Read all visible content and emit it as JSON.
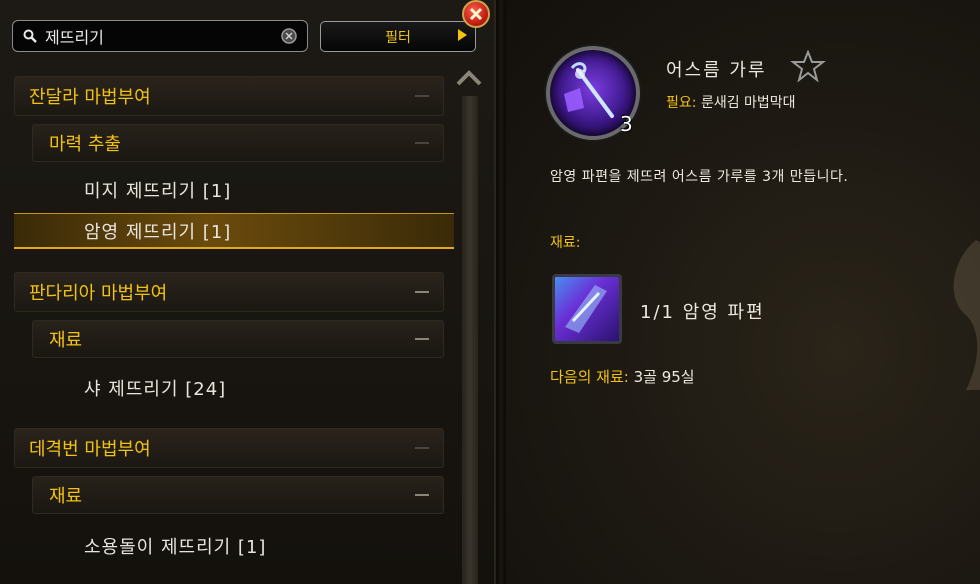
{
  "search": {
    "value": "제뜨리기"
  },
  "filter": {
    "label": "필터"
  },
  "groups": [
    {
      "label": "잔달라 마법부여",
      "sub": {
        "label": "마력 추출",
        "items": [
          {
            "label": "미지 제뜨리기 [1]"
          },
          {
            "label": "암영 제뜨리기 [1]"
          }
        ]
      }
    },
    {
      "label": "판다리아 마법부여",
      "sub": {
        "label": "재료",
        "items": [
          {
            "label": "샤 제뜨리기 [24]"
          }
        ]
      }
    },
    {
      "label": "데격번 마법부여",
      "sub": {
        "label": "재료",
        "items": [
          {
            "label": "소용돌이 제뜨리기 [1]"
          }
        ]
      }
    }
  ],
  "detail": {
    "title": "어스름 가루",
    "stack_count": "3",
    "requires_label": "필요:",
    "requires_value": "룬새김 마법막대",
    "description": "암영 파편을 제뜨려 어스름 가루를 3개 만듭니다.",
    "reagents_label": "재료:",
    "reagent": "1/1 암영 파편",
    "cost_label": "다음의 재료:",
    "cost_value": "3골 95실"
  },
  "colors": {
    "accent": "#f3c211",
    "text": "#ece8de",
    "selection": "#6b4b0c"
  }
}
